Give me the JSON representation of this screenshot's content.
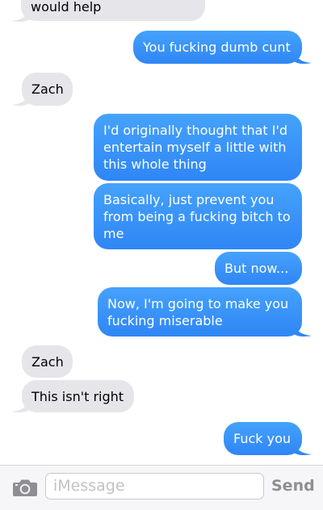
{
  "messages": [
    {
      "direction": "in",
      "text": "would help"
    },
    {
      "direction": "out",
      "text": "You fucking dumb cunt"
    },
    {
      "direction": "in",
      "text": "Zach"
    },
    {
      "direction": "out",
      "text": "I'd originally thought that I'd entertain myself a little with this whole thing"
    },
    {
      "direction": "out",
      "text": "Basically, just prevent you from being a fucking bitch to me"
    },
    {
      "direction": "out",
      "text": "But now..."
    },
    {
      "direction": "out",
      "text": "Now, I'm going to make you fucking miserable"
    },
    {
      "direction": "in",
      "text": "Zach"
    },
    {
      "direction": "in",
      "text": "This isn't right"
    },
    {
      "direction": "out",
      "text": "Fuck you"
    }
  ],
  "composer": {
    "placeholder": "iMessage",
    "send_label": "Send",
    "camera_icon": "camera-icon"
  },
  "colors": {
    "incoming_bubble": "#e5e5ea",
    "outgoing_bubble": "#3b8ff8",
    "send_label": "#8e8e93"
  }
}
